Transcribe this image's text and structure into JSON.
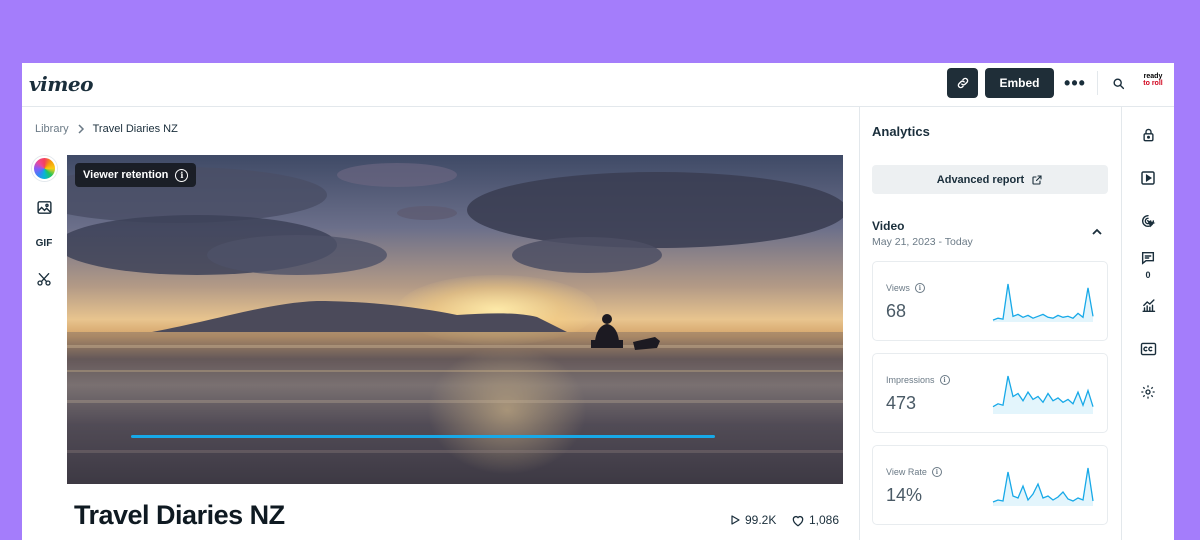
{
  "app": {
    "logo": "vimeo"
  },
  "topbar": {
    "link_icon": "link-icon",
    "embed_label": "Embed",
    "more_label": "•••",
    "search_icon": "search-icon",
    "avatar_text_top": "ready",
    "avatar_text_bottom": "to roll"
  },
  "breadcrumb": {
    "parent": "Library",
    "current": "Travel Diaries NZ"
  },
  "tools": {
    "gif_label": "GIF"
  },
  "player": {
    "retention_label": "Viewer retention"
  },
  "video": {
    "title": "Travel Diaries NZ",
    "plays": "99.2K",
    "likes": "1,086"
  },
  "analytics": {
    "title": "Analytics",
    "advanced_report": "Advanced report",
    "section_title": "Video",
    "date_range": "May 21, 2023 - Today",
    "cards": [
      {
        "label": "Views",
        "value": "68",
        "trend": [
          2,
          4,
          3,
          40,
          6,
          8,
          5,
          7,
          4,
          6,
          8,
          5,
          4,
          7,
          5,
          6,
          4,
          9,
          5,
          36,
          6
        ]
      },
      {
        "label": "Impressions",
        "value": "473",
        "trend": [
          5,
          7,
          6,
          26,
          12,
          14,
          9,
          15,
          10,
          12,
          8,
          14,
          9,
          11,
          8,
          10,
          7,
          15,
          6,
          16,
          5
        ]
      },
      {
        "label": "View Rate",
        "value": "14%",
        "trend": [
          4,
          6,
          5,
          34,
          10,
          8,
          20,
          6,
          12,
          22,
          8,
          10,
          6,
          9,
          14,
          7,
          5,
          8,
          6,
          38,
          5
        ]
      }
    ],
    "accent_color": "#17a9e8"
  },
  "rail": {
    "comments_count": "0"
  }
}
